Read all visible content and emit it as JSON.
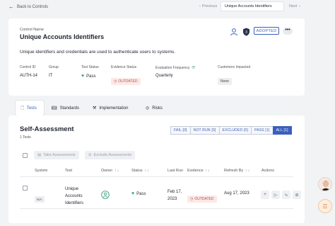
{
  "nav": {
    "back_label": "Back to Controls",
    "prev_label": "Previous",
    "current_label": "Unique Accounts Identifiers",
    "next_label": "Next"
  },
  "control": {
    "name_label": "Control Name",
    "name": "Unique Accounts Identifiers",
    "status_badge": "ADOPTED",
    "more": "•••",
    "description": "Unique identifiers and credentials are used to authenticate users to systems.",
    "fields": {
      "control_id_label": "Control ID",
      "control_id": "AUTH-14",
      "group_label": "Group",
      "group": "IT",
      "test_status_label": "Test Status",
      "test_status": "Pass",
      "evidence_status_label": "Evidence Status",
      "evidence_status": "OUTDATED",
      "evaluation_frequency_label": "Evaluation Frequency",
      "evaluation_frequency": "Quarterly",
      "customers_impacted_label": "Customers Impacted",
      "customers_impacted": "None"
    }
  },
  "tabs": [
    {
      "label": "Tests"
    },
    {
      "label": "Standards"
    },
    {
      "label": "Implementation"
    },
    {
      "label": "Risks"
    }
  ],
  "self_assessment": {
    "title": "Self-Assessment",
    "count": "1 Tests",
    "filters": [
      "FAIL [0]",
      "NOT RUN [0]",
      "EXCLUDED [0]",
      "PASS [1]",
      "ALL [1]"
    ],
    "take_assessments": "Take Assessments",
    "exclude_assessments": "Exclude Assessments",
    "columns": {
      "system": "System",
      "test": "Test",
      "owner": "Owner",
      "status": "Status",
      "last_run": "Last Run",
      "evidence": "Evidence",
      "refresh_by": "Refresh By",
      "actions": "Actions"
    },
    "rows": [
      {
        "system": "N/A",
        "test": [
          "Unique",
          "Accounts",
          "Identifiers"
        ],
        "status": "Pass",
        "last_run": [
          "Feb 17,",
          "2023"
        ],
        "evidence": "OUTDATED",
        "refresh_by": "Aug 17, 2023"
      }
    ]
  },
  "colors": {
    "accent": "#3a5fbe",
    "pass": "#3fa37c",
    "outdated": "#b4564a"
  }
}
